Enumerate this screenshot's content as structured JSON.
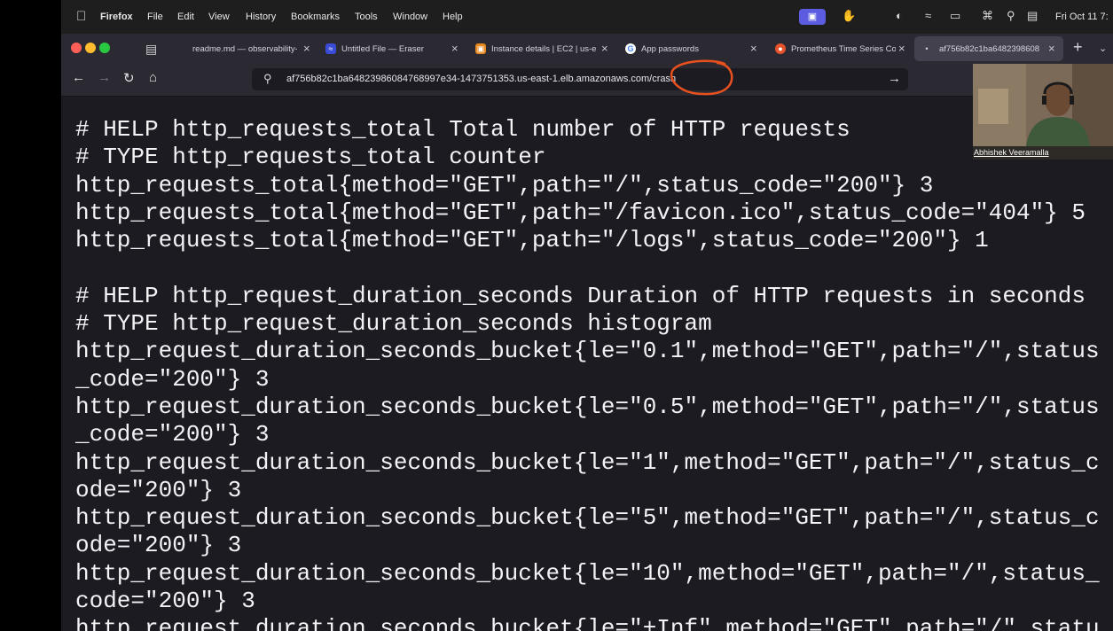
{
  "menubar": {
    "app_name": "Firefox",
    "items": [
      "File",
      "Edit",
      "View",
      "History",
      "Bookmarks",
      "Tools",
      "Window",
      "Help"
    ],
    "clock": "Fri Oct 11 7:"
  },
  "tabs": [
    {
      "label": "readme.md — observability-",
      "favicon": "code-editor-icon"
    },
    {
      "label": "Untitled File — Eraser",
      "favicon": "eraser-app-icon"
    },
    {
      "label": "Instance details | EC2 | us-e",
      "favicon": "aws-ec2-icon"
    },
    {
      "label": "App passwords",
      "favicon": "google-icon"
    },
    {
      "label": "Prometheus Time Series Co",
      "favicon": "prometheus-icon"
    },
    {
      "label": "af756b82c1ba6482398608",
      "favicon": "dot-icon",
      "active": true
    }
  ],
  "urlbar": {
    "value": "af756b82c1ba64823986084768997e34-1473751353.us-east-1.elb.amazonaws.com/crash"
  },
  "content": {
    "lines": [
      "# HELP http_requests_total Total number of HTTP requests",
      "# TYPE http_requests_total counter",
      "http_requests_total{method=\"GET\",path=\"/\",status_code=\"200\"} 3",
      "http_requests_total{method=\"GET\",path=\"/favicon.ico\",status_code=\"404\"} 5",
      "http_requests_total{method=\"GET\",path=\"/logs\",status_code=\"200\"} 1",
      "",
      "# HELP http_request_duration_seconds Duration of HTTP requests in seconds",
      "# TYPE http_request_duration_seconds histogram",
      "http_request_duration_seconds_bucket{le=\"0.1\",method=\"GET\",path=\"/\",status",
      "_code=\"200\"} 3",
      "http_request_duration_seconds_bucket{le=\"0.5\",method=\"GET\",path=\"/\",status",
      "_code=\"200\"} 3",
      "http_request_duration_seconds_bucket{le=\"1\",method=\"GET\",path=\"/\",status_c",
      "ode=\"200\"} 3",
      "http_request_duration_seconds_bucket{le=\"5\",method=\"GET\",path=\"/\",status_c",
      "ode=\"200\"} 3",
      "http_request_duration_seconds_bucket{le=\"10\",method=\"GET\",path=\"/\",status_",
      "code=\"200\"} 3",
      "http_request_duration_seconds_bucket{le=\"+Inf\",method=\"GET\",path=\"/\",statu"
    ]
  },
  "video": {
    "participant_name": "Abhishek Veeramalla"
  },
  "colors": {
    "annotation": "#e8501e",
    "content_bg": "#1c1b22",
    "chrome_bg": "#2b2a33",
    "active_tab": "#42414d"
  }
}
